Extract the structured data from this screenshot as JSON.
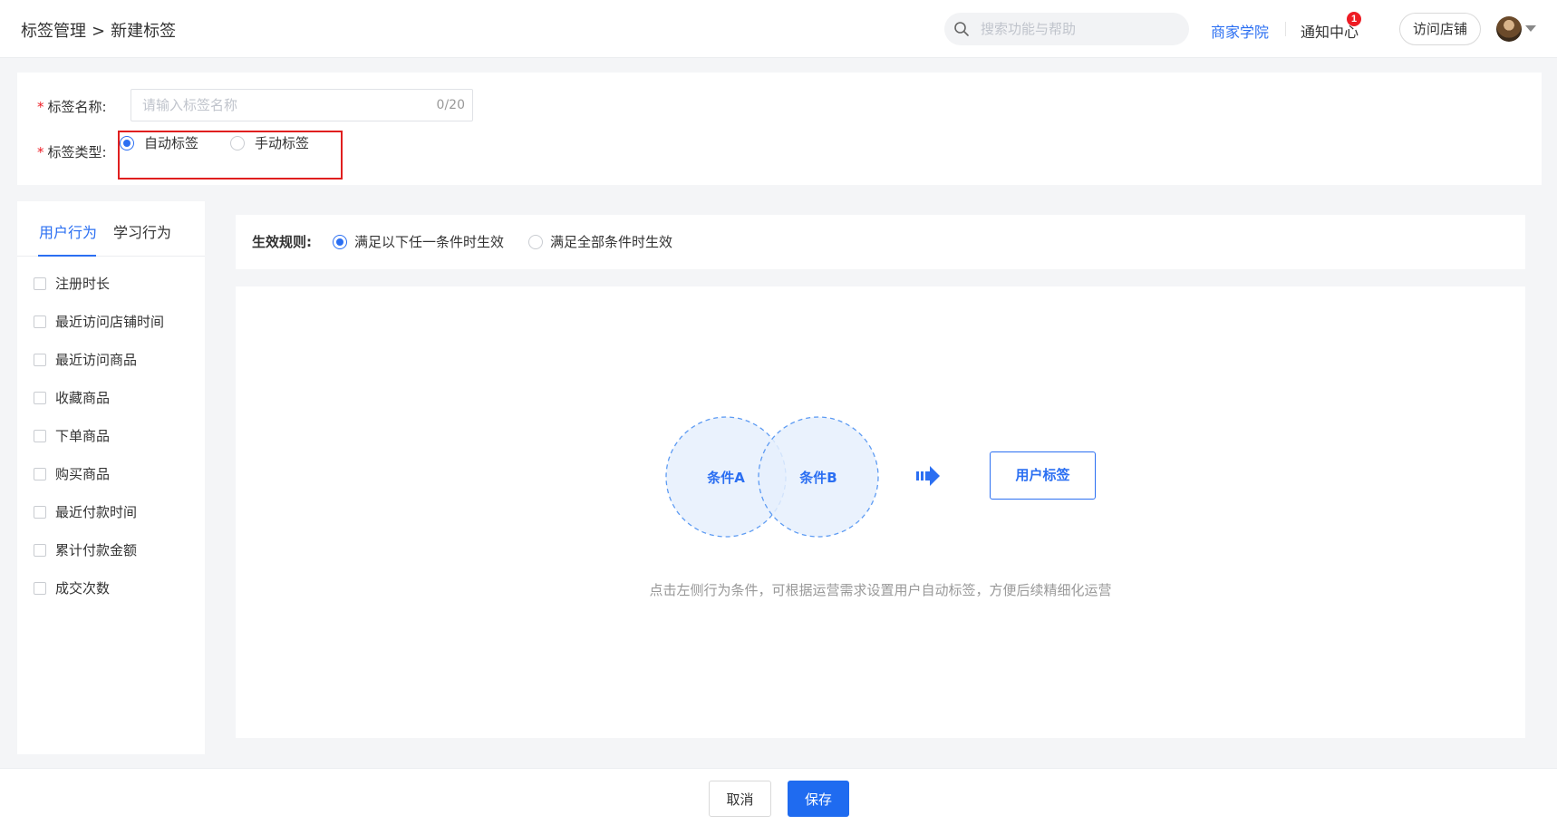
{
  "header": {
    "breadcrumb": {
      "parent": "标签管理",
      "separator": ">",
      "current": "新建标签"
    },
    "search": {
      "placeholder": "搜索功能与帮助"
    },
    "academy_label": "商家学院",
    "notice_label": "通知中心",
    "notice_count": "1",
    "visit_label": "访问店铺",
    "accent_color": "#2b6ff2"
  },
  "form": {
    "name_label": "标签名称:",
    "required_mark": "*",
    "name_placeholder": "请输入标签名称",
    "name_value": "",
    "name_counter": "0/20",
    "type_label": "标签类型:",
    "type_options": [
      {
        "label": "自动标签",
        "selected": true
      },
      {
        "label": "手动标签",
        "selected": false
      }
    ]
  },
  "left_panel": {
    "tabs": [
      {
        "label": "用户行为",
        "active": true
      },
      {
        "label": "学习行为",
        "active": false
      }
    ],
    "conditions": [
      {
        "label": "注册时长",
        "checked": false
      },
      {
        "label": "最近访问店铺时间",
        "checked": false
      },
      {
        "label": "最近访问商品",
        "checked": false
      },
      {
        "label": "收藏商品",
        "checked": false
      },
      {
        "label": "下单商品",
        "checked": false
      },
      {
        "label": "购买商品",
        "checked": false
      },
      {
        "label": "最近付款时间",
        "checked": false
      },
      {
        "label": "累计付款金额",
        "checked": false
      },
      {
        "label": "成交次数",
        "checked": false
      }
    ]
  },
  "rule": {
    "title": "生效规则:",
    "options": [
      {
        "label": "满足以下任一条件时生效",
        "selected": true
      },
      {
        "label": "满足全部条件时生效",
        "selected": false
      }
    ]
  },
  "diagram": {
    "condition_a": "条件A",
    "condition_b": "条件B",
    "target": "用户标签",
    "hint": "点击左侧行为条件，可根据运营需求设置用户自动标签，方便后续精细化运营"
  },
  "footer": {
    "cancel_label": "取消",
    "save_label": "保存"
  }
}
